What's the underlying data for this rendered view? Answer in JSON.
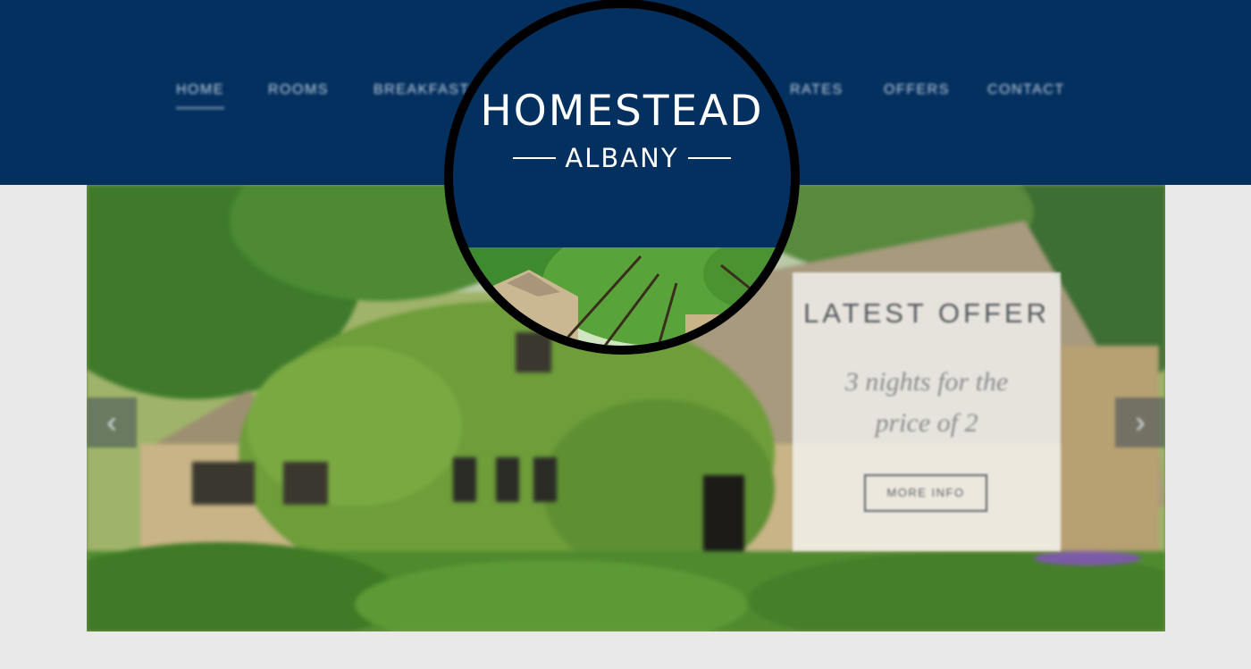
{
  "nav": {
    "items": [
      "HOME",
      "ROOMS",
      "BREAKFAST",
      "RATES",
      "OFFERS",
      "CONTACT"
    ],
    "active": "HOME"
  },
  "logo": {
    "title": "HOMESTEAD",
    "subtitle": "ALBANY"
  },
  "hero": {
    "prev_icon": "‹",
    "next_icon": "›",
    "offer": {
      "title": "LATEST OFFER",
      "text": "3 nights for the price of 2",
      "button": "MORE INFO"
    }
  },
  "colors": {
    "header_bg": "#04305f",
    "page_bg": "#e9e9e9",
    "text_light": "#ffffff"
  }
}
